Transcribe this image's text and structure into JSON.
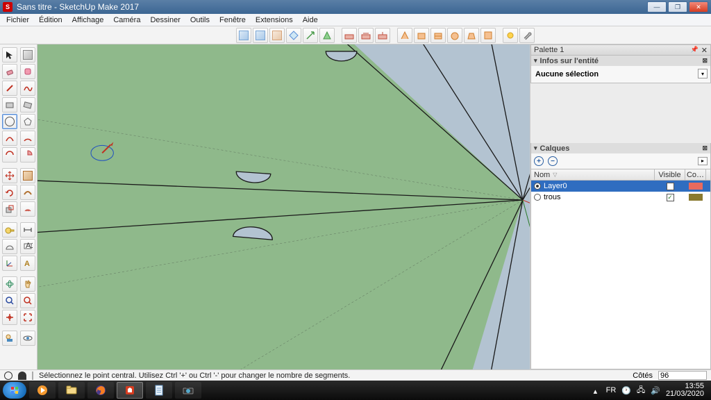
{
  "window": {
    "title": "Sans titre - SketchUp Make 2017",
    "app_badge": "S"
  },
  "menu": [
    "Fichier",
    "Édition",
    "Affichage",
    "Caméra",
    "Dessiner",
    "Outils",
    "Fenêtre",
    "Extensions",
    "Aide"
  ],
  "right": {
    "palette_title": "Palette 1",
    "entity_hdr": "Infos sur l'entité",
    "no_selection": "Aucune sélection",
    "layers_hdr": "Calques",
    "layers_cols": {
      "name": "Nom",
      "visible": "Visible",
      "color": "Co…"
    },
    "layers": [
      {
        "name": "Layer0",
        "selected": true,
        "visible": false,
        "swatch": "#e86a5e"
      },
      {
        "name": "trous",
        "selected": false,
        "visible": true,
        "swatch": "#8a7a2f"
      }
    ]
  },
  "status": {
    "message": "Sélectionnez le point central. Utilisez Ctrl '+' ou Ctrl '-' pour changer le nombre de segments.",
    "field_label": "Côtés",
    "field_value": "96"
  },
  "tray": {
    "lang": "FR",
    "time": "13:55",
    "date": "21/03/2020"
  }
}
